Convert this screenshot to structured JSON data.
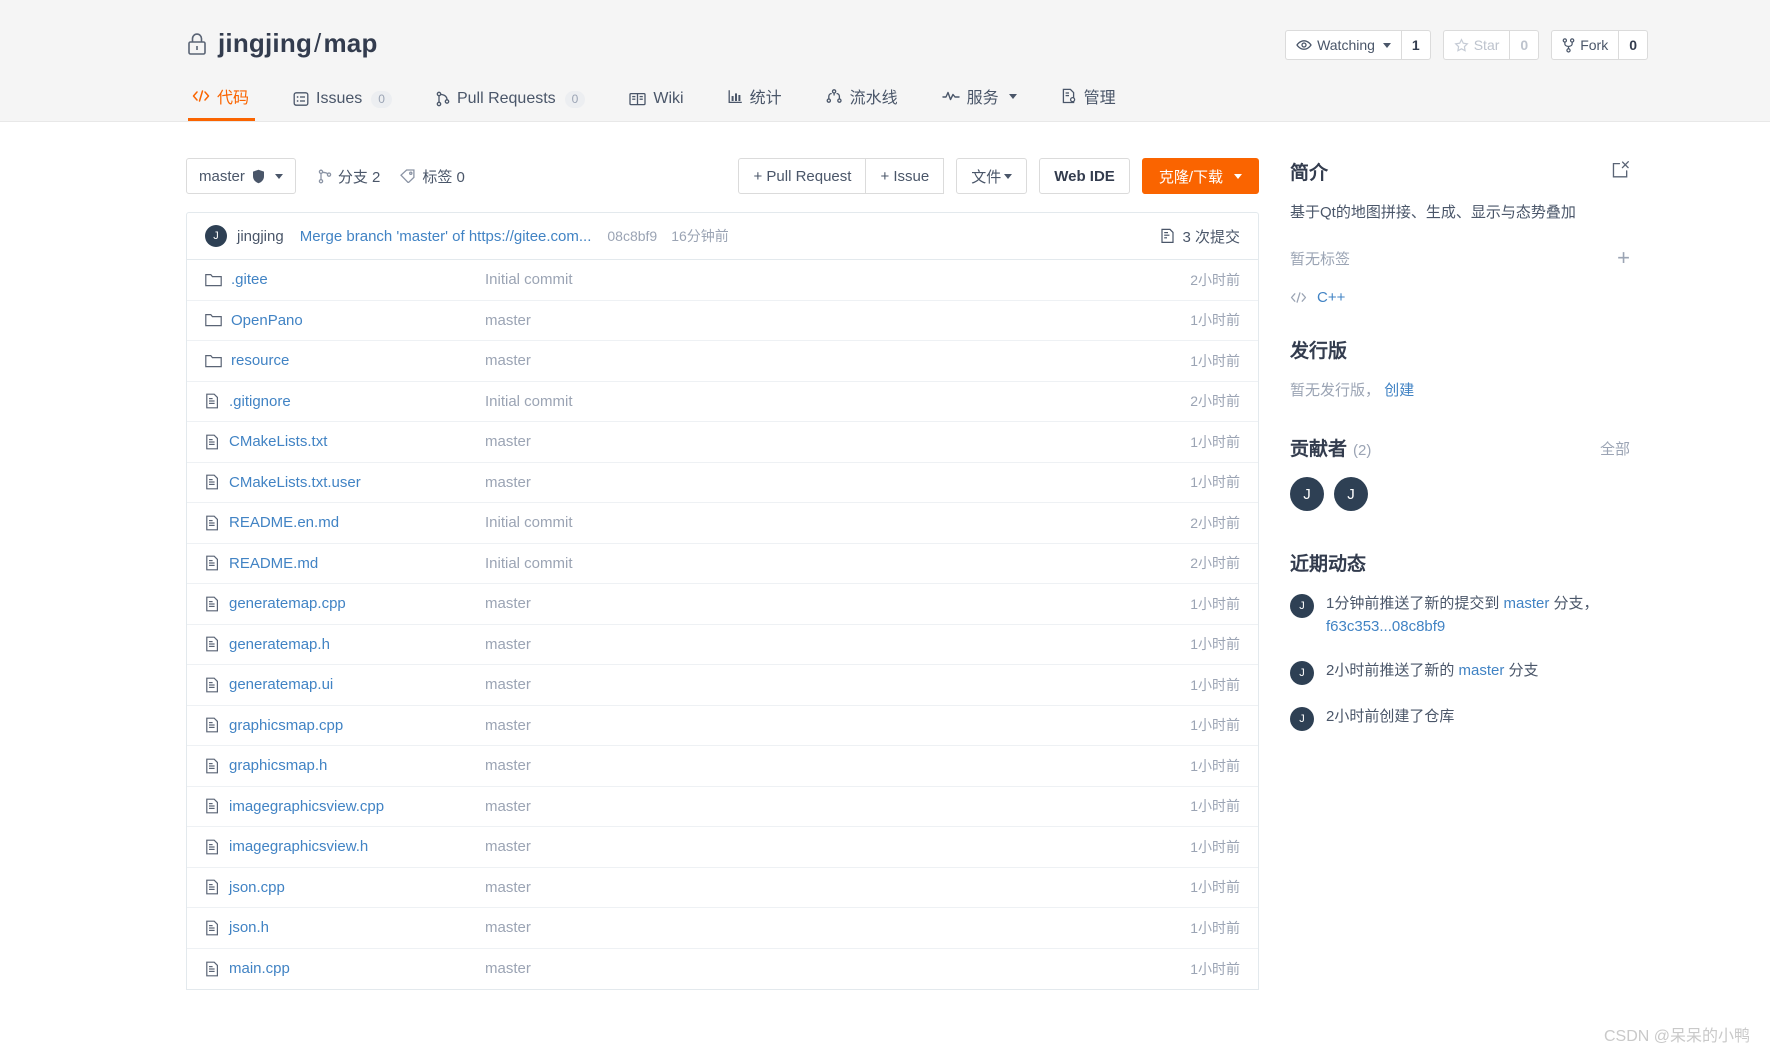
{
  "header": {
    "lock_icon": "lock-icon",
    "owner": "jingjing",
    "separator": "/",
    "repo": "map",
    "actions": {
      "watch_label": "Watching",
      "watch_count": "1",
      "star_label": "Star",
      "star_count": "0",
      "fork_label": "Fork",
      "fork_count": "0"
    },
    "nav": [
      {
        "label": "代码",
        "icon": "code-icon",
        "badge": "",
        "active": true
      },
      {
        "label": "Issues",
        "icon": "issues-icon",
        "badge": "0",
        "active": false
      },
      {
        "label": "Pull Requests",
        "icon": "pull-request-icon",
        "badge": "0",
        "active": false
      },
      {
        "label": "Wiki",
        "icon": "book-icon",
        "badge": "",
        "active": false
      },
      {
        "label": "统计",
        "icon": "chart-icon",
        "badge": "",
        "active": false
      },
      {
        "label": "流水线",
        "icon": "pipeline-icon",
        "badge": "",
        "active": false
      },
      {
        "label": "服务",
        "icon": "pulse-icon",
        "badge": "",
        "active": false,
        "caret": true
      },
      {
        "label": "管理",
        "icon": "settings-doc-icon",
        "badge": "",
        "active": false
      }
    ]
  },
  "toolbar": {
    "branch_name": "master",
    "branch_count_label": "分支 2",
    "tag_count_label": "标签 0",
    "pull_request_button": "+ Pull Request",
    "issue_button": "+ Issue",
    "files_button": "文件",
    "web_ide_button": "Web IDE",
    "clone_button": "克隆/下载"
  },
  "commit_bar": {
    "avatar_letter": "J",
    "author": "jingjing",
    "message": "Merge branch 'master' of https://gitee.com...",
    "sha": "08c8bf9",
    "time": "16分钟前",
    "commit_count_label": "3 次提交"
  },
  "files": [
    {
      "name": ".gitee",
      "type": "folder",
      "commit": "Initial commit",
      "time": "2小时前"
    },
    {
      "name": "OpenPano",
      "type": "folder",
      "commit": "master",
      "time": "1小时前"
    },
    {
      "name": "resource",
      "type": "folder",
      "commit": "master",
      "time": "1小时前"
    },
    {
      "name": ".gitignore",
      "type": "file",
      "commit": "Initial commit",
      "time": "2小时前"
    },
    {
      "name": "CMakeLists.txt",
      "type": "file",
      "commit": "master",
      "time": "1小时前"
    },
    {
      "name": "CMakeLists.txt.user",
      "type": "file",
      "commit": "master",
      "time": "1小时前"
    },
    {
      "name": "README.en.md",
      "type": "file",
      "commit": "Initial commit",
      "time": "2小时前"
    },
    {
      "name": "README.md",
      "type": "file",
      "commit": "Initial commit",
      "time": "2小时前"
    },
    {
      "name": "generatemap.cpp",
      "type": "file",
      "commit": "master",
      "time": "1小时前"
    },
    {
      "name": "generatemap.h",
      "type": "file",
      "commit": "master",
      "time": "1小时前"
    },
    {
      "name": "generatemap.ui",
      "type": "file",
      "commit": "master",
      "time": "1小时前"
    },
    {
      "name": "graphicsmap.cpp",
      "type": "file",
      "commit": "master",
      "time": "1小时前"
    },
    {
      "name": "graphicsmap.h",
      "type": "file",
      "commit": "master",
      "time": "1小时前"
    },
    {
      "name": "imagegraphicsview.cpp",
      "type": "file",
      "commit": "master",
      "time": "1小时前"
    },
    {
      "name": "imagegraphicsview.h",
      "type": "file",
      "commit": "master",
      "time": "1小时前"
    },
    {
      "name": "json.cpp",
      "type": "file",
      "commit": "master",
      "time": "1小时前"
    },
    {
      "name": "json.h",
      "type": "file",
      "commit": "master",
      "time": "1小时前"
    },
    {
      "name": "main.cpp",
      "type": "file",
      "commit": "master",
      "time": "1小时前"
    }
  ],
  "sidebar": {
    "about_title": "简介",
    "about_description": "基于Qt的地图拼接、生成、显示与态势叠加",
    "no_tags_label": "暂无标签",
    "language": "C++",
    "release_title": "发行版",
    "release_empty": "暂无发行版，",
    "release_create": "创建",
    "contributors_title": "贡献者",
    "contributors_count": "(2)",
    "contributors_all": "全部",
    "contributors": [
      {
        "letter": "J"
      },
      {
        "letter": "J"
      }
    ],
    "activity_title": "近期动态",
    "activities": [
      {
        "avatar_letter": "J",
        "prefix": "1分钟前推送了新的提交到 ",
        "link": "master",
        "middle": " 分支，",
        "link2": "f63c353...08c8bf9",
        "suffix": ""
      },
      {
        "avatar_letter": "J",
        "prefix": "2小时前推送了新的 ",
        "link": "master",
        "middle": " 分支",
        "link2": "",
        "suffix": ""
      },
      {
        "avatar_letter": "J",
        "prefix": "2小时前创建了仓库",
        "link": "",
        "middle": "",
        "link2": "",
        "suffix": ""
      }
    ]
  },
  "watermark": "CSDN @呆呆的小鸭",
  "colors": {
    "accent": "#fa6400",
    "link": "#4183c4",
    "text": "#4a5669",
    "heading": "#333c4e",
    "muted": "#9ba4b4",
    "avatar_bg": "#2e4054"
  }
}
